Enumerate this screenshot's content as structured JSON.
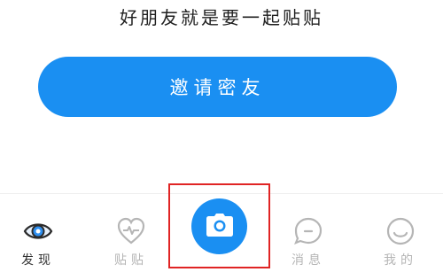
{
  "tagline": "好朋友就是要一起贴贴",
  "invite_button_label": "邀请密友",
  "tabs": [
    {
      "label": "发现",
      "icon": "eye-icon",
      "active": true
    },
    {
      "label": "贴贴",
      "icon": "heart-pulse-icon",
      "active": false
    },
    {
      "label": "消息",
      "icon": "message-bubble-icon",
      "active": false
    },
    {
      "label": "我的",
      "icon": "smiley-face-icon",
      "active": false
    }
  ],
  "center_action": {
    "icon": "camera-icon",
    "highlighted": true
  },
  "colors": {
    "accent": "#1a8ff2",
    "highlight_box": "#e02424",
    "tab_active_text": "#333333",
    "tab_inactive": "#b5b5b5"
  }
}
